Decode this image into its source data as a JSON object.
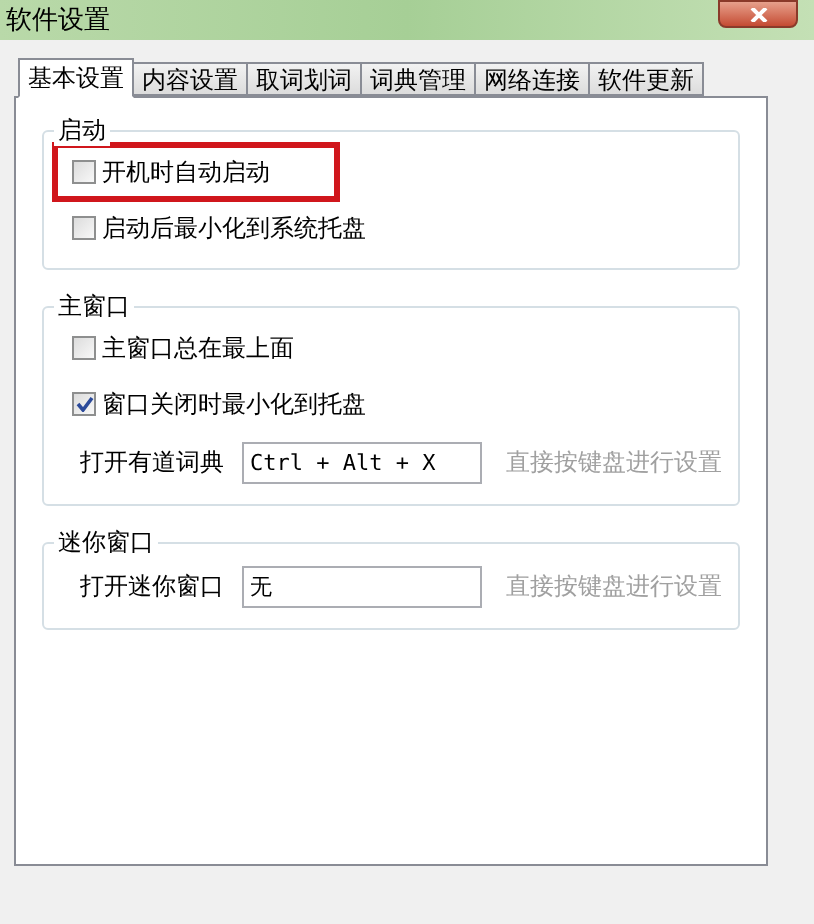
{
  "window": {
    "title": "软件设置"
  },
  "tabs": [
    {
      "label": "基本设置",
      "selected": true
    },
    {
      "label": "内容设置",
      "selected": false
    },
    {
      "label": "取词划词",
      "selected": false
    },
    {
      "label": "词典管理",
      "selected": false
    },
    {
      "label": "网络连接",
      "selected": false
    },
    {
      "label": "软件更新",
      "selected": false
    }
  ],
  "groups": [
    {
      "title": "启动",
      "items": [
        {
          "kind": "checkbox",
          "label": "开机时自动启动",
          "checked": false,
          "highlighted": true
        },
        {
          "kind": "checkbox",
          "label": "启动后最小化到系统托盘",
          "checked": false,
          "highlighted": false
        }
      ]
    },
    {
      "title": "主窗口",
      "items": [
        {
          "kind": "checkbox",
          "label": "主窗口总在最上面",
          "checked": false,
          "highlighted": false
        },
        {
          "kind": "checkbox",
          "label": "窗口关闭时最小化到托盘",
          "checked": true,
          "highlighted": false
        },
        {
          "kind": "hotkey",
          "label": "打开有道词典",
          "value": "Ctrl + Alt + X",
          "hint": "直接按键盘进行设置"
        }
      ]
    },
    {
      "title": "迷你窗口",
      "items": [
        {
          "kind": "hotkey",
          "label": "打开迷你窗口",
          "value": "无",
          "hint": "直接按键盘进行设置"
        }
      ]
    }
  ]
}
